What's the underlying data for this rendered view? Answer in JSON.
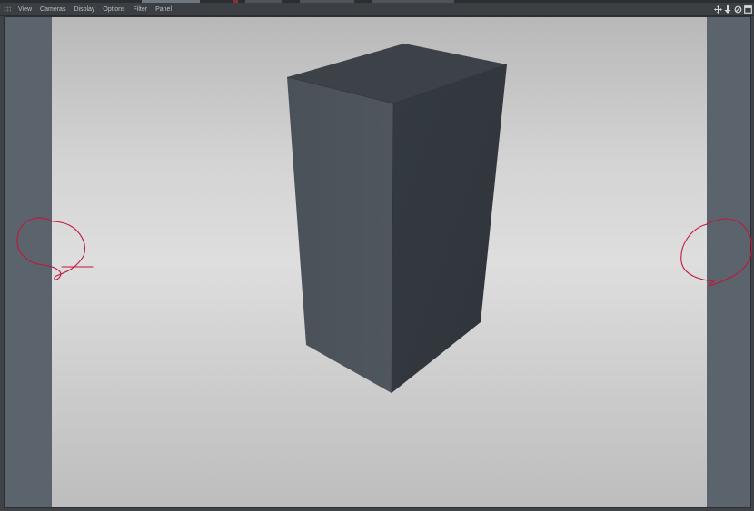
{
  "menubar": {
    "items": [
      "View",
      "Cameras",
      "Display",
      "Options",
      "Filter",
      "Panel"
    ]
  },
  "nav_icons": [
    "move-view-icon",
    "dolly-view-icon",
    "rotate-view-icon",
    "maximize-view-icon"
  ],
  "colors": {
    "ui_background": "#3f4347",
    "menu_text": "#b9c0c7",
    "safe_frame_bar": "#5b646d",
    "viewport_center": "#dedede",
    "viewport_edge": "#b8b8b8",
    "cube_top": "#3e4349",
    "cube_left": "#4c535b",
    "cube_right": "#343a40",
    "annotation_ink": "#c0173f"
  },
  "scene": {
    "object": "box"
  }
}
